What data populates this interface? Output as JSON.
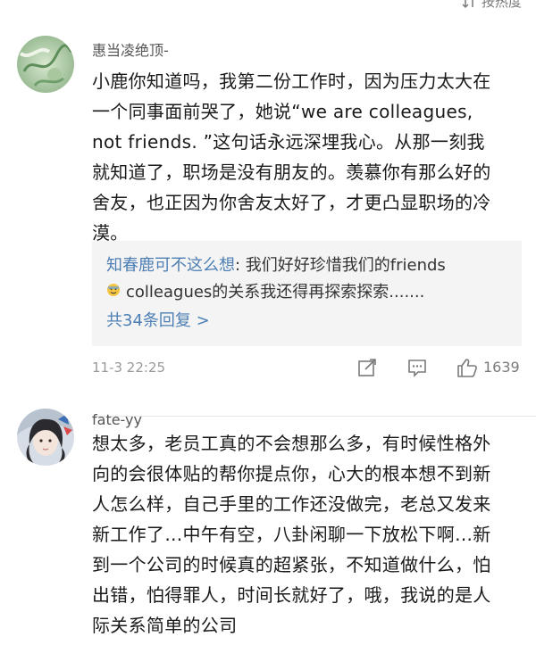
{
  "header": {
    "sort_label": "按热度"
  },
  "comments": [
    {
      "username": "惠当凌绝顶-",
      "text": "小鹿你知道吗，我第二份工作时，因为压力太大在\n一个同事面前哭了，她说“we are colleagues,\nnot friends. ”这句话永远深埋我心。从那一刻我\n就知道了，职场是没有朋友的。羡慕你有那么好的\n舍友，也正因为你舍友太好了，才更凸显职场的冷\n漠。",
      "reply": {
        "user": "知春鹿可不这么想",
        "text_line1": ": 我们好好珍惜我们的friends",
        "text_line2": "colleagues的关系我还得再探索探索.......",
        "more": "共34条回复 >"
      },
      "time": "11-3 22:25",
      "like_count": "1639"
    },
    {
      "username": "fate-yy",
      "text": "想太多，老员工真的不会想那么多，有时候性格外\n向的会很体贴的帮你提点你，心大的根本想不到新\n人怎么样，自己手里的工作还没做完，老总又发来\n新工作了…中午有空，八卦闲聊一下放松下啊…新\n到一个公司的时候真的超紧张，不知道做什么，怕\n出错，怕得罪人，时间长就好了，哦，我说的是人\n际关系简单的公司"
    }
  ]
}
